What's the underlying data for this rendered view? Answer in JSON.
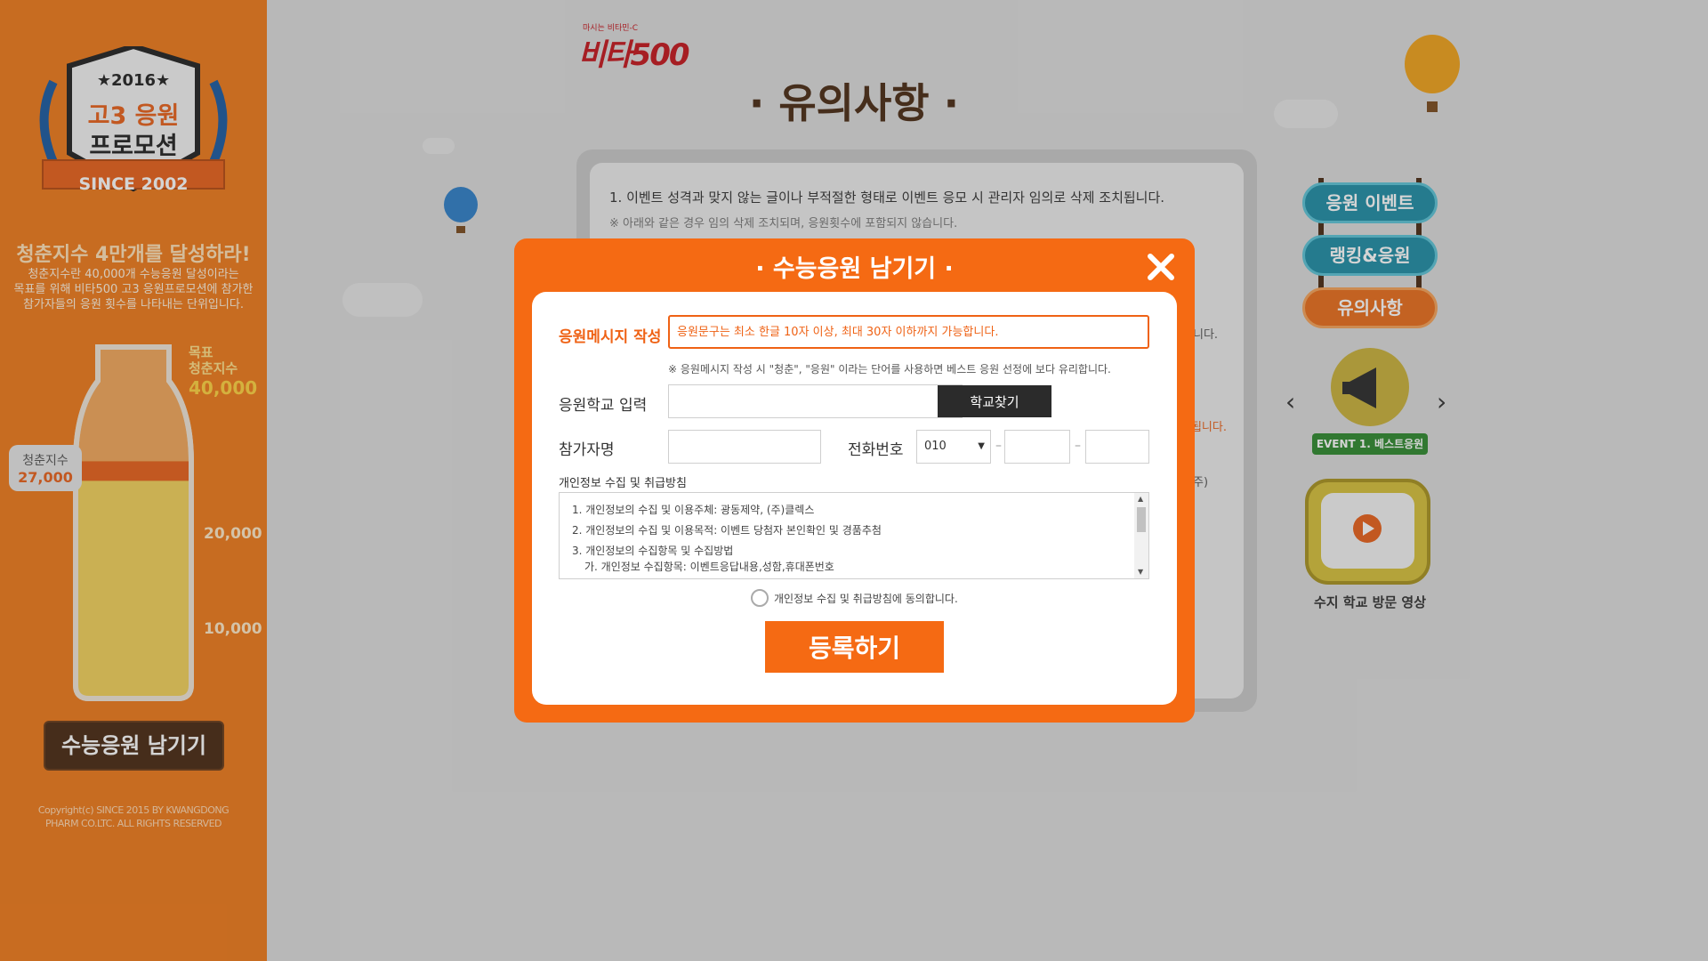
{
  "sidebar": {
    "badge": {
      "year": "★2016★",
      "line1": "고3 응원",
      "line2": "프로모션",
      "since": "SINCE 2002"
    },
    "slogan": "청춘지수 4만개를 달성하라!",
    "description": "청춘지수란 40,000개 수능응원 달성이라는\n목표를 위해 비타500 고3 응원프로모션에 참가한\n참가자들의 응원 횟수를 나타내는 단위입니다.",
    "goal_label": "목표",
    "goal_sub": "청춘지수",
    "goal_value": "40,000",
    "mark_20000": "20,000",
    "mark_10000": "10,000",
    "current_label": "청춘지수",
    "current_value": "27,000",
    "current_fraction": 0.675,
    "cta_label": "수능응원 남기기",
    "copyright": "Copyright(c) SINCE 2015 BY KWANGDONG\nPHARM CO.LTC. ALL RIGHTS RESERVED"
  },
  "brand": {
    "tag": "마시는 비타민-C",
    "name": "비타500"
  },
  "page_title": "· 유의사항 ·",
  "notice": {
    "item1": "1. 이벤트 성격과 맞지 않는 글이나 부적절한 형태로 이벤트 응모 시 관리자 임의로 삭제 조치됩니다.",
    "item1_sub": "※ 아래와 같은 경우 임의 삭제 조치되며, 응원횟수에 포함되지 않습니다.",
    "tail_a": "니다.",
    "tail_b": "지됩니다.",
    "tail_c": "주)"
  },
  "right_nav": {
    "items": [
      {
        "label": "응원 이벤트",
        "color": "#1f8ea6"
      },
      {
        "label": "랭킹&응원",
        "color": "#1f8ea6"
      },
      {
        "label": "유의사항",
        "color": "#e96d1b"
      }
    ],
    "event_label": "EVENT 1. 베스트응원",
    "prev_icon": "‹",
    "next_icon": "›",
    "video_caption": "수지 학교 방문 영상"
  },
  "modal": {
    "title": "· 수능응원 남기기 ·",
    "message_label": "응원메시지 작성",
    "message_placeholder": "응원문구는 최소 한글 10자 이상, 최대 30자 이하까지 가능합니다.",
    "message_hint": "※ 응원메시지 작성 시 \"청춘\", \"응원\" 이라는 단어를 사용하면 베스트 응원 선정에 보다 유리합니다.",
    "school_label": "응원학교 입력",
    "school_value": "",
    "school_button": "학교찾기",
    "name_label": "참가자명",
    "name_value": "",
    "phone_label": "전화번호",
    "phone_prefix": "010",
    "phone_mid": "",
    "phone_last": "",
    "phone_dash": "–",
    "privacy_title": "개인정보 수집 및 취급방침",
    "privacy_lines": [
      "1. 개인정보의 수집 및 이용주체: 광동제약, (주)클렉스",
      "2. 개인정보의 수집 및 이용목적: 이벤트 당첨자 본인확인 및 경품추첨",
      "3. 개인정보의 수집항목 및 수집방법"
    ],
    "privacy_sub": "가. 개인정보 수집항목: 이벤트응답내용,성함,휴대폰번호",
    "agree_label": "개인정보 수집 및 취급방침에 동의합니다.",
    "submit_label": "등록하기"
  },
  "colors": {
    "orange": "#f56a13",
    "sidebar": "#ef7a1a",
    "brown": "#4a2b14",
    "teal": "#1f8ea6"
  }
}
